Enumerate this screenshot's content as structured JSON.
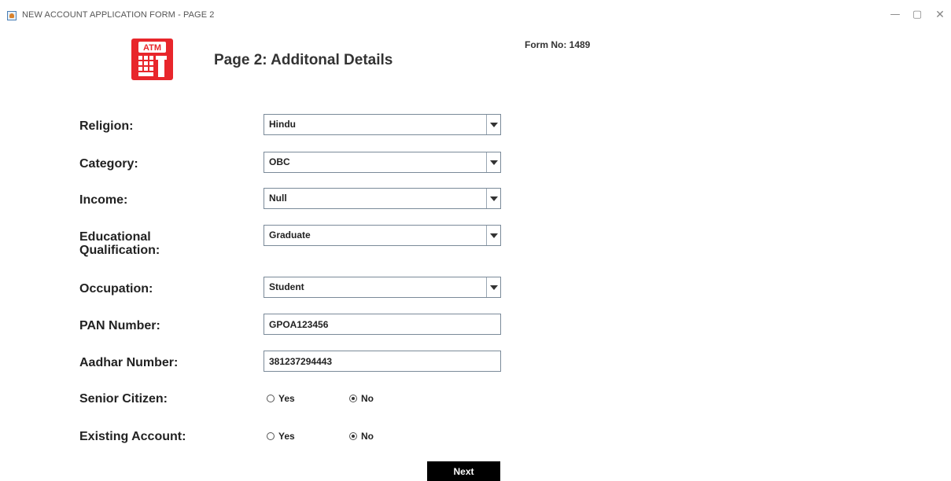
{
  "window": {
    "title": "NEW ACCOUNT APPLICATION FORM - PAGE 2",
    "controls": {
      "minimize": "—",
      "maximize": "▢",
      "close": "✕"
    }
  },
  "header": {
    "logo_text": "ATM",
    "page_title": "Page 2: Additonal Details",
    "form_no": "Form No: 1489"
  },
  "colors": {
    "logo_red": "#e8262b",
    "button_bg": "#000000",
    "button_text": "#ffffff"
  },
  "fields": {
    "religion": {
      "label": "Religion:",
      "value": "Hindu"
    },
    "category": {
      "label": "Category:",
      "value": "OBC"
    },
    "income": {
      "label": "Income:",
      "value": "Null"
    },
    "education": {
      "label_line1": "Educational",
      "label_line2": "Qualification:",
      "value": "Graduate"
    },
    "occupation": {
      "label": "Occupation:",
      "value": "Student"
    },
    "pan": {
      "label": "PAN Number:",
      "value": "GPOA123456"
    },
    "aadhar": {
      "label": "Aadhar Number:",
      "value": "381237294443"
    },
    "senior_citizen": {
      "label": "Senior Citizen:",
      "yes_label": "Yes",
      "no_label": "No",
      "selected": "No"
    },
    "existing_account": {
      "label": "Existing Account:",
      "yes_label": "Yes",
      "no_label": "No",
      "selected": "No"
    }
  },
  "actions": {
    "next_label": "Next"
  }
}
